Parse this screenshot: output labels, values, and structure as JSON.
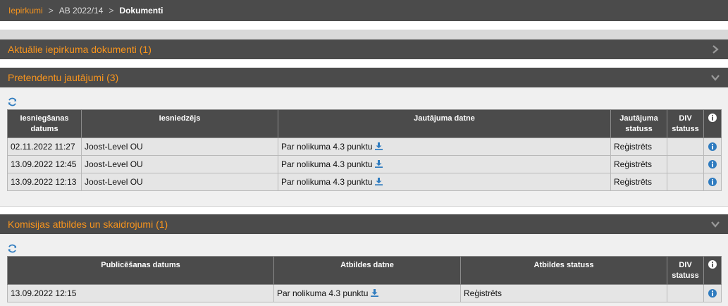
{
  "breadcrumb": {
    "root": "Iepirkumi",
    "separator1": ">",
    "middle": "AB 2022/14",
    "separator2": ">",
    "current": "Dokumenti"
  },
  "panels": {
    "documents": {
      "title": "Aktuālie iepirkuma dokumenti (1)",
      "state": "collapsed"
    },
    "questions": {
      "title": "Pretendentu jautājumi (3)",
      "state": "expanded",
      "columns": [
        "Iesniegšanas datums",
        "Iesniedzējs",
        "Jautājuma datne",
        "Jautājuma statuss",
        "DIV statuss"
      ],
      "rows": [
        {
          "date": "02.11.2022 11:27",
          "submitter": "Joost-Level OU",
          "file": "Par nolikuma 4.3 punktu",
          "status": "Reģistrēts",
          "div": ""
        },
        {
          "date": "13.09.2022 12:45",
          "submitter": "Joost-Level OU",
          "file": "Par nolikuma 4.3 punktu",
          "status": "Reģistrēts",
          "div": ""
        },
        {
          "date": "13.09.2022 12:13",
          "submitter": "Joost-Level OU",
          "file": "Par nolikuma 4.3 punktu",
          "status": "Reģistrēts",
          "div": ""
        }
      ]
    },
    "answers": {
      "title": "Komisijas atbildes un skaidrojumi (1)",
      "state": "expanded",
      "columns": [
        "Publicēšanas datums",
        "Atbildes datne",
        "Atbildes statuss",
        "DIV statuss"
      ],
      "rows": [
        {
          "date": "13.09.2022 12:15",
          "file": "Par nolikuma 4.3 punktu",
          "status": "Reģistrēts",
          "div": ""
        }
      ]
    }
  },
  "icons": {
    "refresh": "refresh-icon",
    "download": "download-icon",
    "info": "info-icon",
    "chevron_right": "chevron-right-icon",
    "chevron_down": "chevron-down-icon"
  },
  "colors": {
    "accent": "#f7941d",
    "header_bg": "#4b4b4b",
    "icon_blue": "#2e7bbf",
    "row_bg": "#e5e5e5"
  }
}
